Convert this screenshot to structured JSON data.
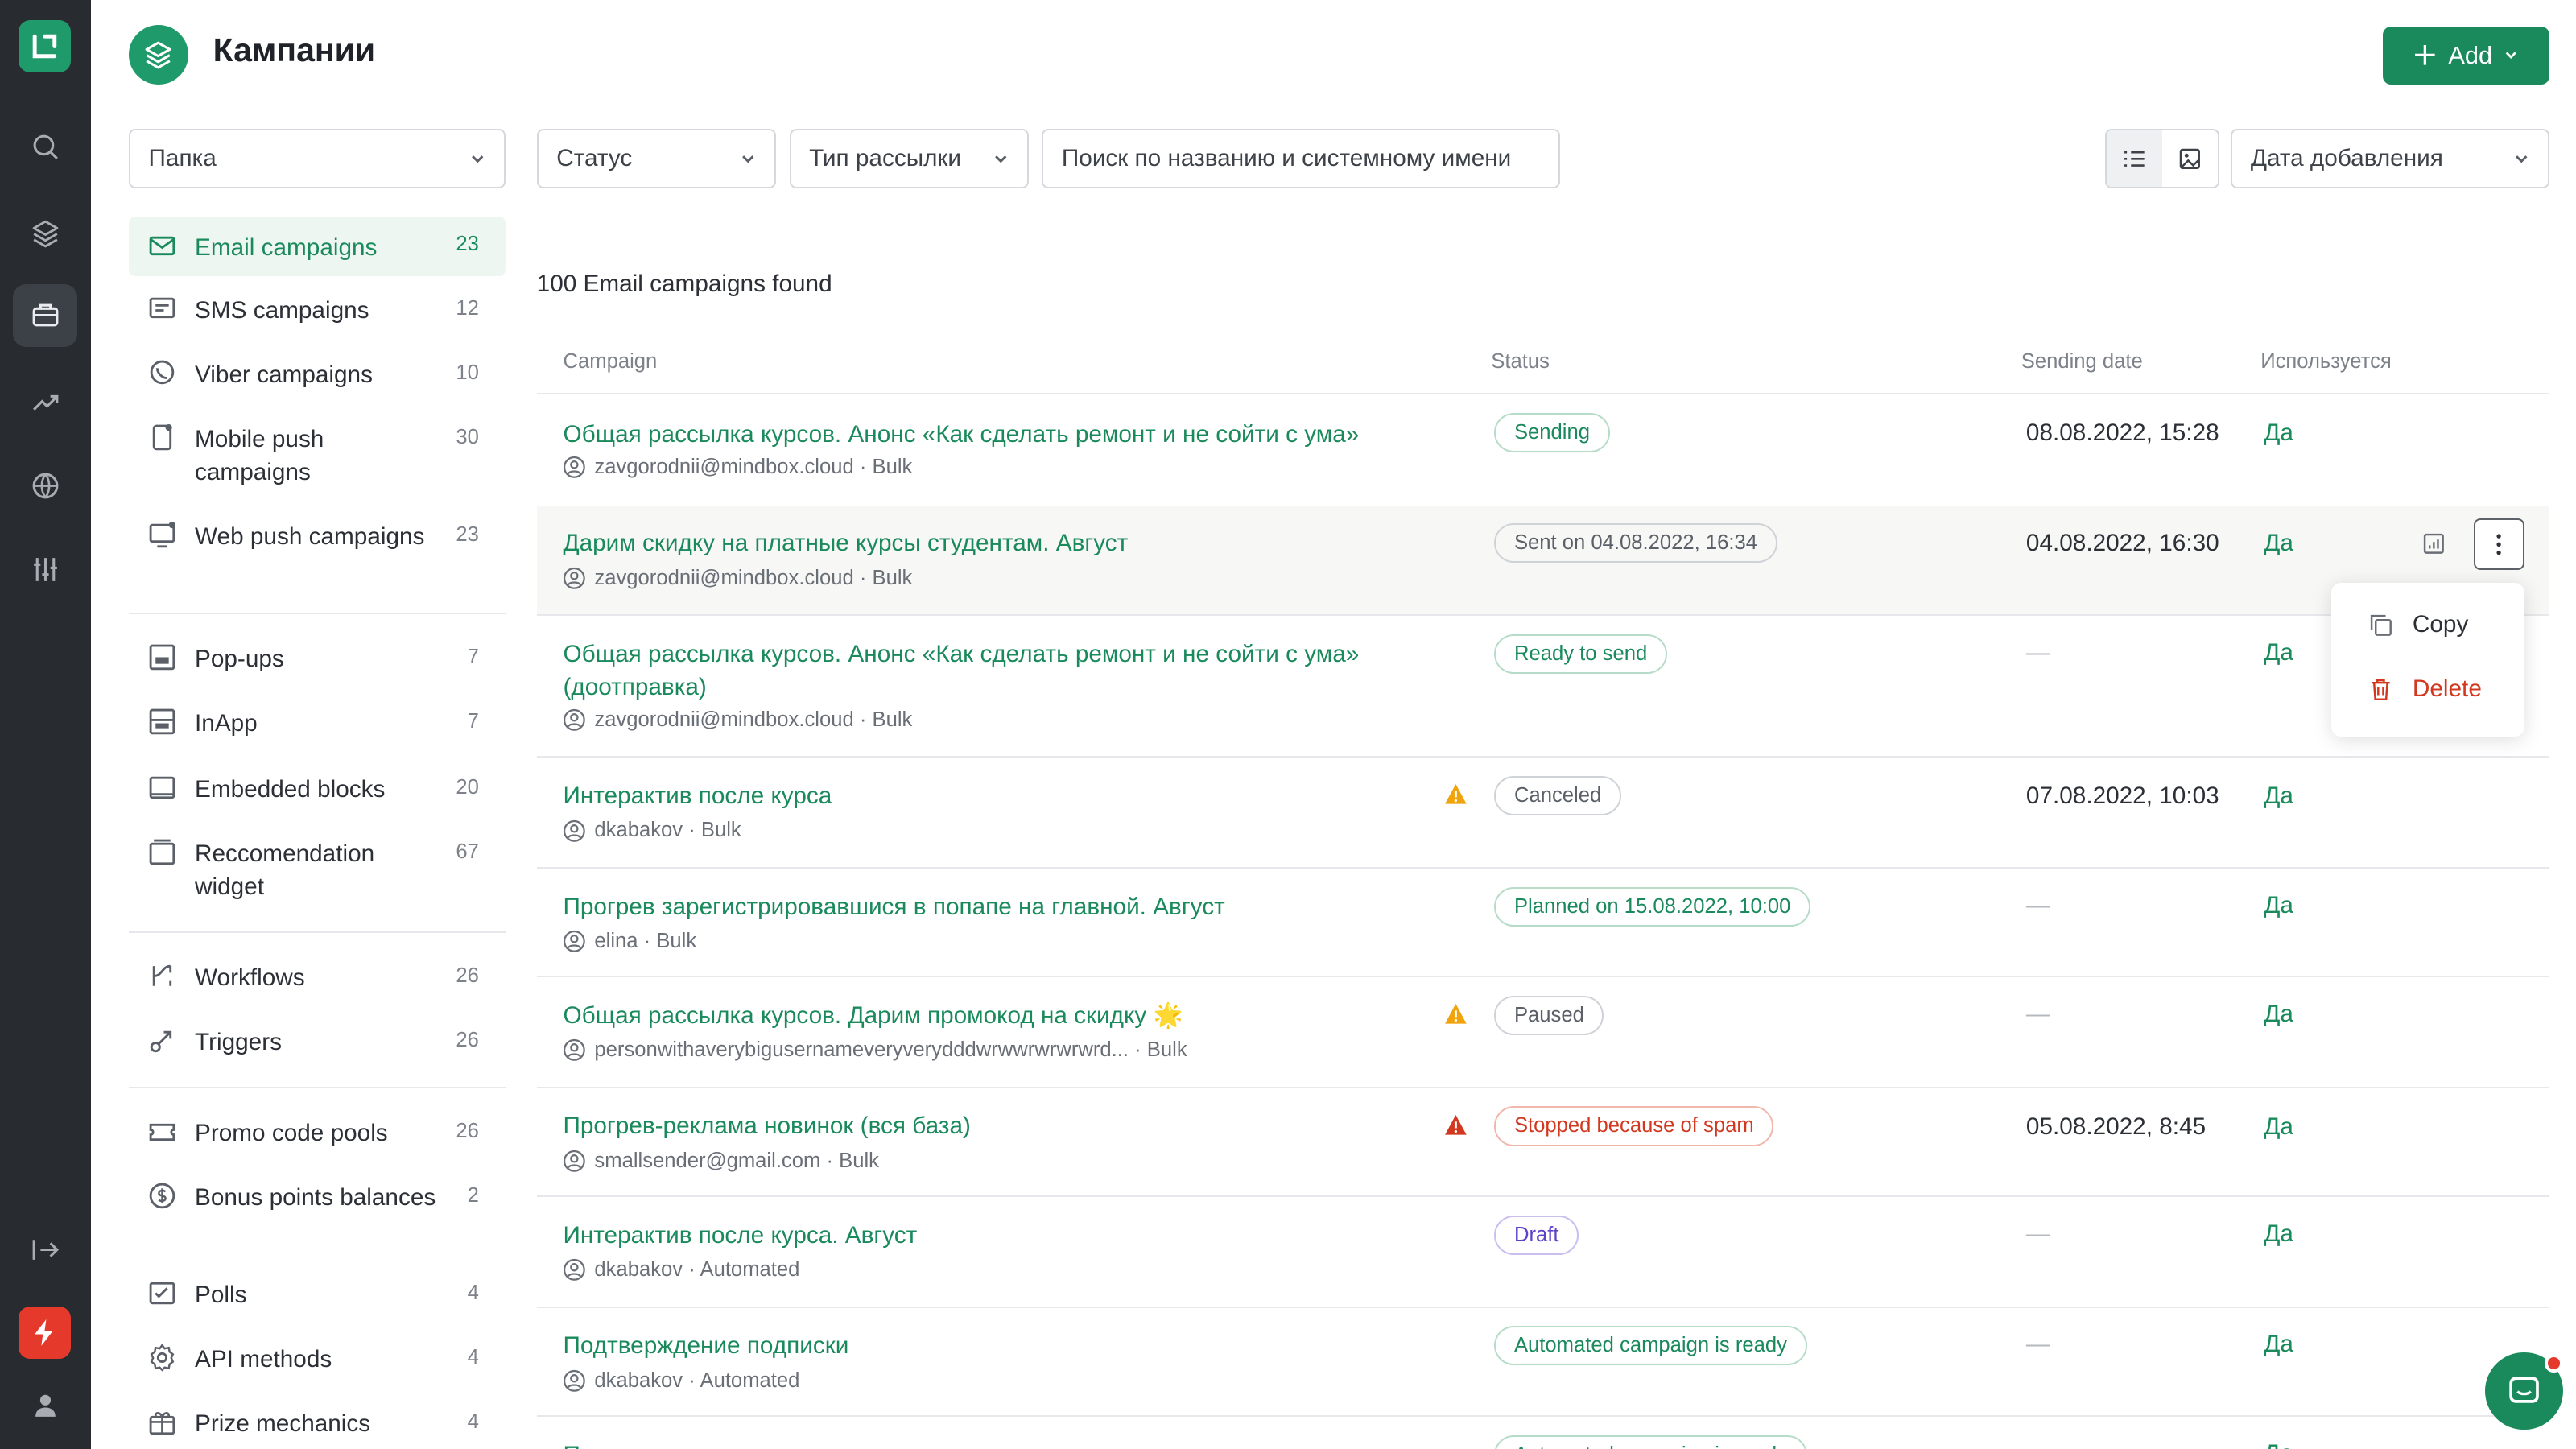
{
  "header": {
    "title": "Кампании",
    "add_label": "Add"
  },
  "filters": {
    "folder": "Папка",
    "status": "Статус",
    "mailing_type": "Тип рассылки",
    "search_placeholder": "Поиск по названию и системному имени",
    "sort": "Дата добавления"
  },
  "sidebar": {
    "items": [
      {
        "label": "Email campaigns",
        "count": "23"
      },
      {
        "label": "SMS campaigns",
        "count": "12"
      },
      {
        "label": "Viber campaigns",
        "count": "10"
      },
      {
        "label": "Mobile push campaigns",
        "count": "30"
      },
      {
        "label": "Web push campaigns",
        "count": "23"
      },
      {
        "label": "Pop-ups",
        "count": "7"
      },
      {
        "label": "InApp",
        "count": "7"
      },
      {
        "label": "Embedded blocks",
        "count": "20"
      },
      {
        "label": "Reccomendation widget",
        "count": "67"
      },
      {
        "label": "Workflows",
        "count": "26"
      },
      {
        "label": "Triggers",
        "count": "26"
      },
      {
        "label": "Promo code pools",
        "count": "26"
      },
      {
        "label": "Bonus points balances",
        "count": "2"
      },
      {
        "label": "Polls",
        "count": "4"
      },
      {
        "label": "API methods",
        "count": "4"
      },
      {
        "label": "Prize mechanics",
        "count": "4"
      }
    ]
  },
  "results": {
    "found_text": "100 Email campaigns found"
  },
  "table": {
    "columns": [
      "Campaign",
      "Status",
      "Sending date",
      "Используется"
    ],
    "rows": [
      {
        "title": "Общая рассылка курсов. Анонс «Как сделать ремонт и не сойти с ума»",
        "meta": "zavgorodnii@mindbox.cloud · Bulk",
        "status": "Sending",
        "date": "08.08.2022, 15:28",
        "used": "Да"
      },
      {
        "title": "Дарим скидку на платные курсы студентам. Август",
        "meta": "zavgorodnii@mindbox.cloud · Bulk",
        "status": "Sent on 04.08.2022, 16:34",
        "date": "04.08.2022, 16:30",
        "used": "Да"
      },
      {
        "title": "Общая рассылка курсов. Анонс «Как сделать ремонт и не сойти с ума» (доотправка)",
        "meta": "zavgorodnii@mindbox.cloud · Bulk",
        "status": "Ready to send",
        "date": "—",
        "used": "Да"
      },
      {
        "title": "Интерактив после курса",
        "meta": "dkabakov · Bulk",
        "status": "Canceled",
        "date": "07.08.2022, 10:03",
        "used": "Да"
      },
      {
        "title": "Прогрев зарегистрировавшися в попапе на главной. Август",
        "meta": "elina · Bulk",
        "status": "Planned on 15.08.2022, 10:00",
        "date": "—",
        "used": "Да"
      },
      {
        "title": "Общая рассылка курсов. Дарим промокод на скидку 🌟",
        "meta": "personwithaverybigusernameveryverydddwrwwrwrwrwrd... · Bulk",
        "status": "Paused",
        "date": "—",
        "used": "Да"
      },
      {
        "title": "Прогрев-реклама новинок (вся база)",
        "meta": "smallsender@gmail.com · Bulk",
        "status": "Stopped because of spam",
        "date": "05.08.2022, 8:45",
        "used": "Да"
      },
      {
        "title": "Интерактив после курса. Август",
        "meta": "dkabakov · Automated",
        "status": "Draft",
        "date": "—",
        "used": "Да"
      },
      {
        "title": "Подтверждение подписки",
        "meta": "dkabakov · Automated",
        "status": "Automated campaign is ready",
        "date": "—",
        "used": "Да"
      },
      {
        "title": "Приветственное письмо после подписки",
        "meta": "",
        "status": "Automated campaign is ready",
        "date": "",
        "used": "Да"
      }
    ]
  },
  "context_menu": {
    "copy": "Copy",
    "delete": "Delete"
  },
  "colors": {
    "accent": "#1a8a5c",
    "danger": "#d1381f",
    "warning": "#f0a30a",
    "rail": "#282b30"
  }
}
